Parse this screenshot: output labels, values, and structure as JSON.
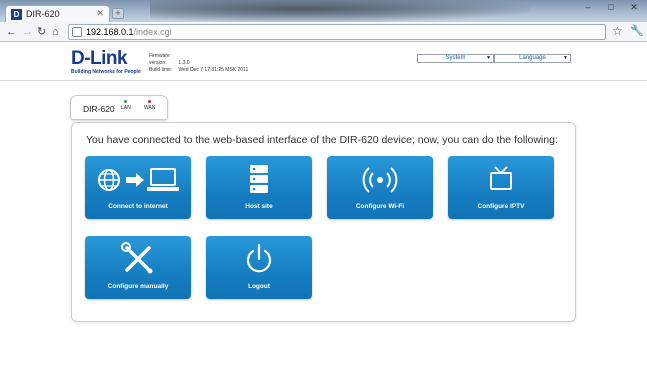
{
  "browser": {
    "tab_title": "DIR-620",
    "favicon": "D",
    "url_host": "192.168.0.1",
    "url_path": "/index.cgi"
  },
  "header": {
    "logo_text": "D-Link",
    "logo_tagline": "Building Networks for People",
    "firmware_label": "Firmware version:",
    "firmware_value": "1.3.0",
    "build_label": "Build time:",
    "build_value": "Wed Dec 7 17:31:25 MSK 2011",
    "system_menu": "System",
    "language_menu": "Language"
  },
  "device": {
    "name": "DIR-620",
    "lan_label": "LAN",
    "wan_label": "WAN",
    "lan_color": "#3aa63a",
    "wan_color": "#d02020"
  },
  "main": {
    "intro_text": "You have connected to the web-based interface of the DIR-620 device; now, you can do the following:",
    "tiles": [
      {
        "label": "Connect to internet",
        "icon": "globe-to-computer-icon"
      },
      {
        "label": "Host site",
        "icon": "server-icon"
      },
      {
        "label": "Configure Wi-Fi",
        "icon": "wifi-icon"
      },
      {
        "label": "Configure IPTV",
        "icon": "tv-icon"
      },
      {
        "label": "Configure manually",
        "icon": "tools-icon"
      },
      {
        "label": "Logout",
        "icon": "power-icon"
      }
    ]
  },
  "colors": {
    "tile_blue": "#1a87c9",
    "brand_blue": "#1b3c8c"
  }
}
